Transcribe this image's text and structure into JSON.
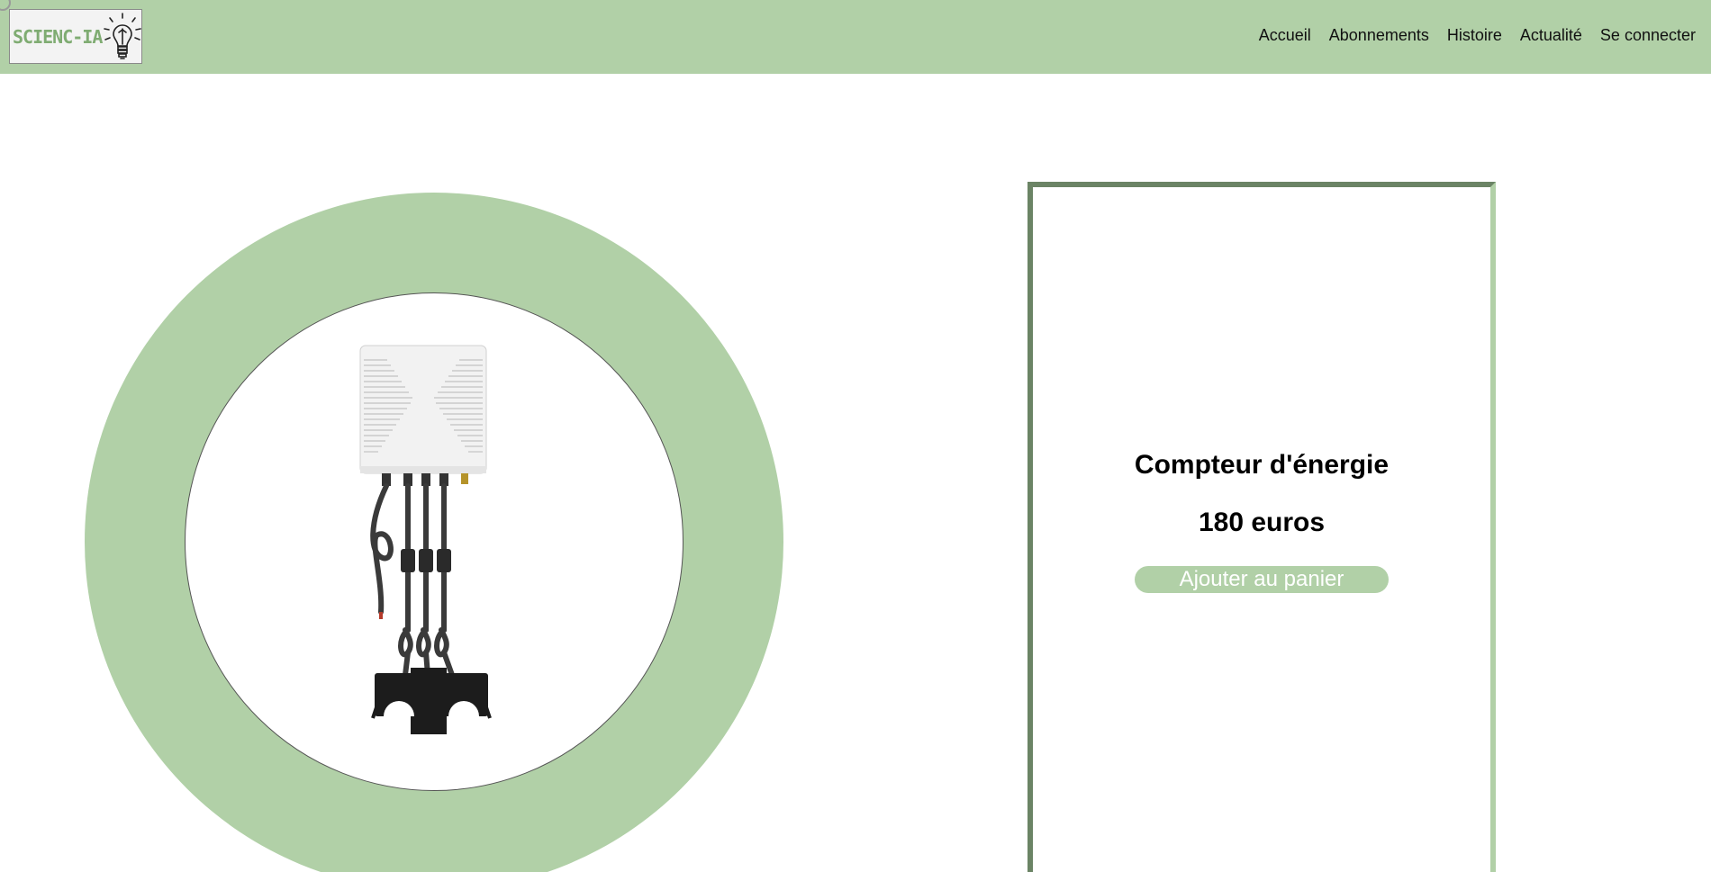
{
  "header": {
    "logo_text": "SCIENC-IA",
    "logo_icon": "lightbulb-icon",
    "nav": [
      {
        "label": "Accueil"
      },
      {
        "label": "Abonnements"
      },
      {
        "label": "Histoire"
      },
      {
        "label": "Actualité"
      },
      {
        "label": "Se connecter"
      }
    ]
  },
  "product": {
    "title": "Compteur d'énergie",
    "price": "180 euros",
    "add_to_cart_label": "Ajouter au panier",
    "image": "energy-meter-with-clamps"
  },
  "colors": {
    "accent": "#b1d0a7",
    "accent_dark": "#6b8465",
    "logo_text": "#7fac72"
  }
}
